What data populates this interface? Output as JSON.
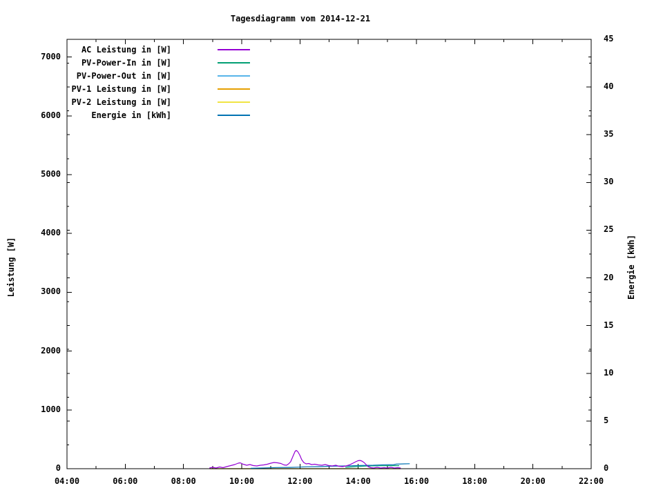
{
  "title": "Tagesdiagramm vom 2014-12-21",
  "legend": {
    "entries": [
      {
        "label": "AC Leistung in [W]",
        "color": "#9400d3"
      },
      {
        "label": "PV-Power-In in [W]",
        "color": "#009e73"
      },
      {
        "label": "PV-Power-Out in [W]",
        "color": "#56b4e9"
      },
      {
        "label": "PV-1 Leistung in [W]",
        "color": "#e69f00"
      },
      {
        "label": "PV-2 Leistung in [W]",
        "color": "#f0e442"
      },
      {
        "label": "Energie in [kWh]",
        "color": "#0072b2"
      }
    ]
  },
  "chart_data": {
    "type": "line",
    "title": "Tagesdiagramm vom 2014-12-21",
    "x_axis": {
      "label": "",
      "range": [
        4,
        22
      ],
      "tick_hours": [
        4,
        6,
        8,
        10,
        12,
        14,
        16,
        18,
        20,
        22
      ],
      "tick_labels": [
        "04:00",
        "06:00",
        "08:00",
        "10:00",
        "12:00",
        "14:00",
        "16:00",
        "18:00",
        "20:00",
        "22:00"
      ],
      "minor_hours": [
        5,
        7,
        9,
        11,
        13,
        15,
        17,
        19,
        21
      ]
    },
    "y_axis": {
      "label": "Leistung [W]",
      "range": [
        0,
        7300
      ],
      "ticks": [
        0,
        1000,
        2000,
        3000,
        4000,
        5000,
        6000,
        7000
      ]
    },
    "y2_axis": {
      "label": "Energie [kWh]",
      "range": [
        0,
        45
      ],
      "ticks": [
        0,
        5,
        10,
        15,
        20,
        25,
        30,
        35,
        40,
        45
      ],
      "minor_ticks": [
        2.5,
        7.5,
        12.5,
        17.5,
        22.5,
        27.5,
        32.5,
        37.5,
        42.5
      ]
    },
    "grid": false,
    "legend_position": "top-left-inside",
    "series": [
      {
        "name": "PV-Power-Out in [W]",
        "color": "#56b4e9",
        "axis": "y1",
        "points": [
          [
            8.9,
            0
          ],
          [
            15.45,
            0
          ]
        ]
      },
      {
        "name": "PV-1 Leistung in [W]",
        "color": "#e69f00",
        "axis": "y1",
        "points": [
          [
            8.9,
            0
          ],
          [
            15.45,
            0
          ]
        ]
      },
      {
        "name": "PV-2 Leistung in [W]",
        "color": "#f0e442",
        "axis": "y1",
        "points": [
          [
            8.9,
            0
          ],
          [
            15.45,
            0
          ]
        ]
      },
      {
        "name": "PV-Power-In in [W]",
        "color": "#009e73",
        "axis": "y1",
        "points": [
          [
            13.56,
            23
          ],
          [
            13.91,
            35
          ],
          [
            14.27,
            45
          ],
          [
            14.63,
            49
          ],
          [
            14.98,
            52
          ],
          [
            15.22,
            53
          ],
          [
            15.41,
            52
          ]
        ]
      },
      {
        "name": "Energie in [kWh]",
        "color": "#0072b2",
        "axis": "y2",
        "points": [
          [
            10.31,
            0.04
          ],
          [
            10.71,
            0.07
          ],
          [
            11.19,
            0.12
          ],
          [
            11.66,
            0.14
          ],
          [
            11.9,
            0.16
          ],
          [
            12.25,
            0.2
          ],
          [
            12.61,
            0.22
          ],
          [
            13.08,
            0.26
          ],
          [
            13.56,
            0.29
          ],
          [
            14.03,
            0.33
          ],
          [
            14.51,
            0.36
          ],
          [
            14.89,
            0.41
          ],
          [
            15.22,
            0.43
          ],
          [
            15.31,
            0.48
          ],
          [
            15.58,
            0.51
          ],
          [
            15.77,
            0.52
          ]
        ]
      },
      {
        "name": "AC Leistung in [W]",
        "color": "#9400d3",
        "axis": "y1",
        "points": [
          [
            8.89,
            12
          ],
          [
            9.0,
            23
          ],
          [
            9.12,
            12
          ],
          [
            9.24,
            29
          ],
          [
            9.36,
            18
          ],
          [
            9.48,
            35
          ],
          [
            9.62,
            53
          ],
          [
            9.76,
            70
          ],
          [
            9.88,
            94
          ],
          [
            9.95,
            100
          ],
          [
            10.05,
            76
          ],
          [
            10.17,
            59
          ],
          [
            10.28,
            70
          ],
          [
            10.4,
            53
          ],
          [
            10.52,
            47
          ],
          [
            10.64,
            59
          ],
          [
            10.76,
            65
          ],
          [
            10.88,
            76
          ],
          [
            11.0,
            94
          ],
          [
            11.11,
            106
          ],
          [
            11.23,
            100
          ],
          [
            11.35,
            88
          ],
          [
            11.45,
            65
          ],
          [
            11.54,
            59
          ],
          [
            11.61,
            82
          ],
          [
            11.68,
            117
          ],
          [
            11.76,
            211
          ],
          [
            11.83,
            293
          ],
          [
            11.87,
            311
          ],
          [
            11.92,
            293
          ],
          [
            11.99,
            235
          ],
          [
            12.06,
            153
          ],
          [
            12.13,
            106
          ],
          [
            12.21,
            82
          ],
          [
            12.3,
            88
          ],
          [
            12.4,
            70
          ],
          [
            12.51,
            76
          ],
          [
            12.63,
            65
          ],
          [
            12.75,
            59
          ],
          [
            12.87,
            70
          ],
          [
            12.99,
            53
          ],
          [
            13.11,
            47
          ],
          [
            13.23,
            59
          ],
          [
            13.34,
            41
          ],
          [
            13.46,
            35
          ],
          [
            13.58,
            47
          ],
          [
            13.7,
            65
          ],
          [
            13.82,
            94
          ],
          [
            13.91,
            117
          ],
          [
            13.99,
            135
          ],
          [
            14.06,
            141
          ],
          [
            14.13,
            129
          ],
          [
            14.2,
            106
          ],
          [
            14.27,
            70
          ],
          [
            14.34,
            35
          ],
          [
            14.44,
            18
          ],
          [
            14.53,
            12
          ],
          [
            14.65,
            23
          ],
          [
            14.77,
            12
          ],
          [
            14.89,
            18
          ],
          [
            15.0,
            12
          ],
          [
            15.12,
            23
          ],
          [
            15.24,
            12
          ],
          [
            15.36,
            18
          ],
          [
            15.46,
            12
          ]
        ]
      }
    ]
  }
}
